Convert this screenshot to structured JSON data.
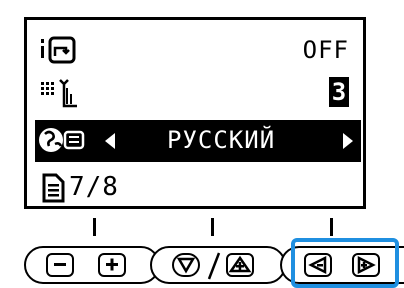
{
  "screen": {
    "row1": {
      "icon": "thread-cutter-icon",
      "value": "OFF"
    },
    "row2": {
      "icon": "presser-foot-pressure-icon",
      "value": "3"
    },
    "row3": {
      "icon": "language-globe-icon",
      "value": "РУССКИЙ"
    },
    "row4": {
      "icon": "page-icon",
      "value": "7/8"
    }
  },
  "buttons": {
    "group1": {
      "left": "−",
      "right": "+"
    },
    "group2": {
      "left": "▽",
      "separator": "/",
      "right": "+"
    },
    "group3": {
      "left": "◁",
      "right": "▷"
    }
  },
  "accent_color": "#1f8fe0"
}
